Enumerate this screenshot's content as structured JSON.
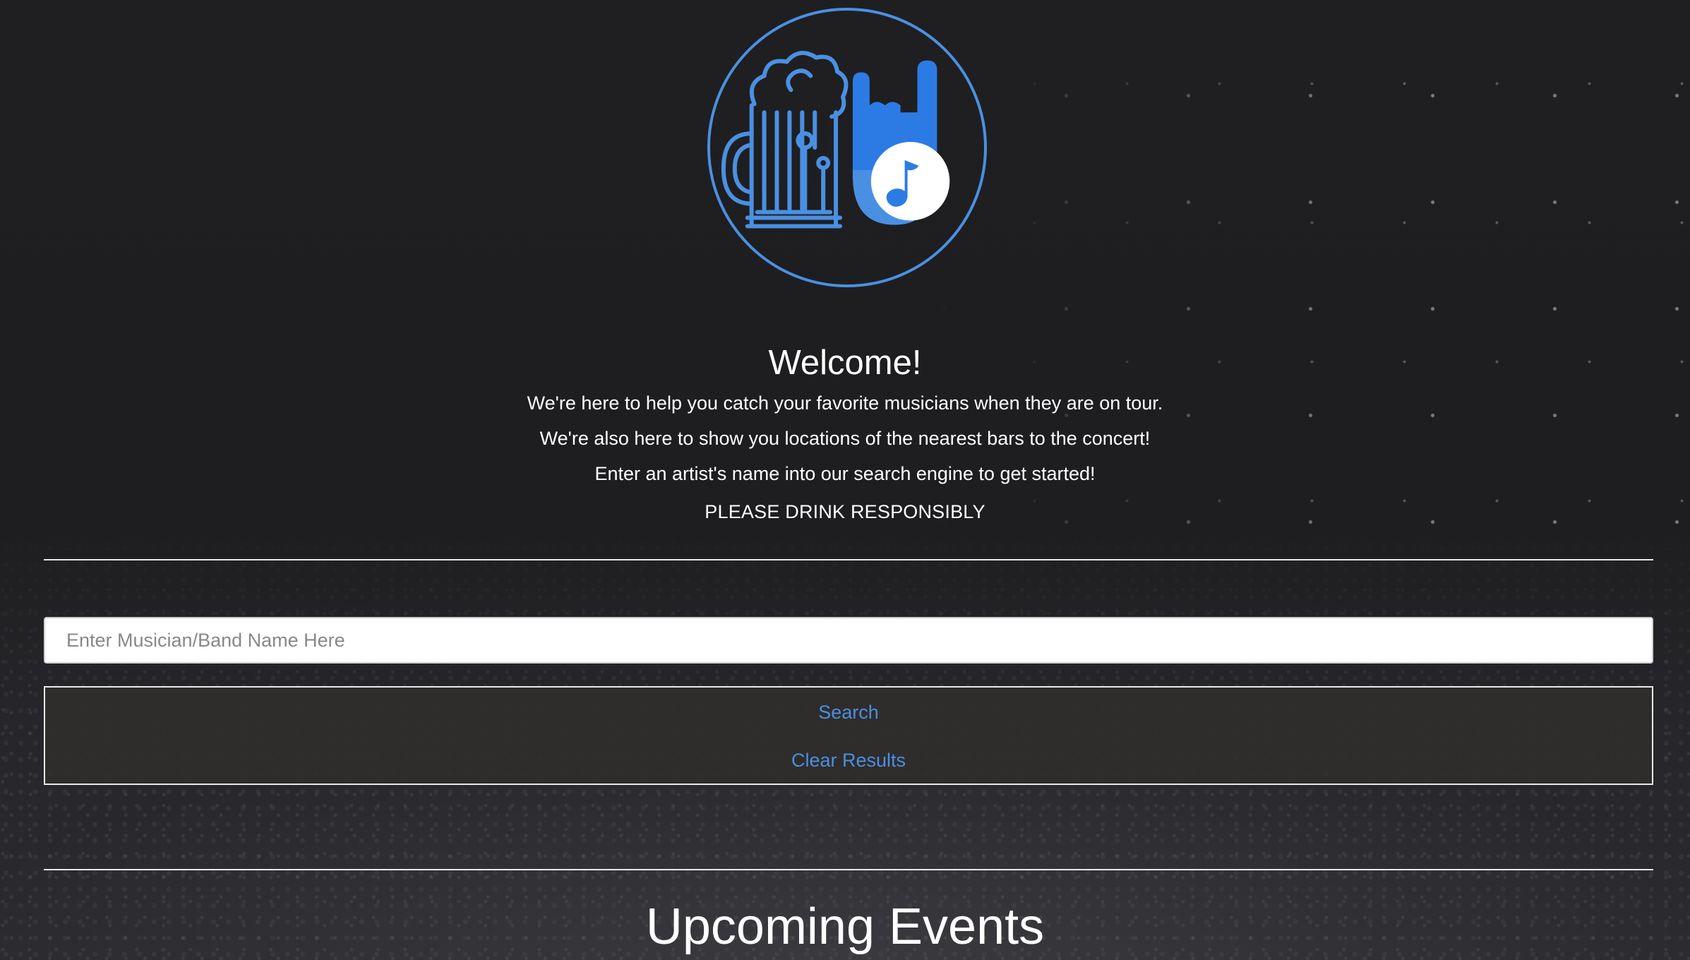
{
  "logo": {
    "name": "beer-rock-music-logo",
    "accent": "#4a90e2"
  },
  "intro": {
    "title": "Welcome!",
    "lines": [
      "We're here to help you catch your favorite musicians when they are on tour.",
      "We're also here to show you locations of the nearest bars to the concert!",
      "Enter an artist's name into our search engine to get started!"
    ],
    "warning": "PLEASE DRINK RESPONSIBLY"
  },
  "search": {
    "placeholder": "Enter Musician/Band Name Here",
    "value": "",
    "search_label": "Search",
    "clear_label": "Clear Results"
  },
  "events": {
    "heading": "Upcoming Events"
  },
  "colors": {
    "background": "#1f1f21",
    "link": "#4a8fe0",
    "text": "#ffffff"
  }
}
